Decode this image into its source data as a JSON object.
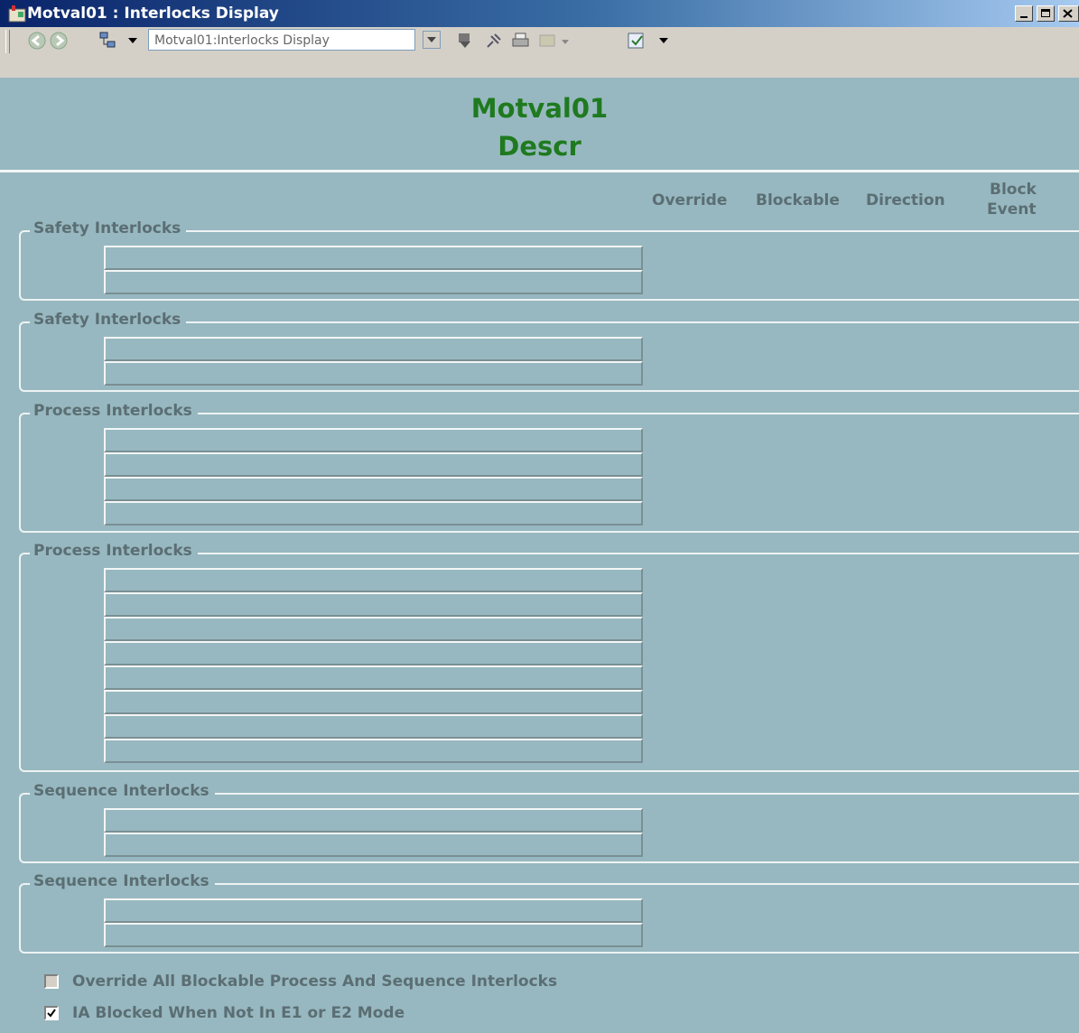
{
  "window": {
    "title": "Motval01 : Interlocks Display"
  },
  "toolbar": {
    "address_value": "Motval01:Interlocks Display",
    "icons": [
      "back-icon",
      "forward-icon",
      "network-icon",
      "download-icon",
      "pin-icon",
      "print-icon",
      "switch-icon",
      "checkmark-icon"
    ]
  },
  "header": {
    "title": "Motval01",
    "description": "Descr"
  },
  "columns": {
    "override": "Override",
    "blockable": "Blockable",
    "direction": "Direction",
    "block_event_1": "Block",
    "block_event_2": "Event"
  },
  "groups": [
    {
      "label": "Safety Interlocks",
      "rows": 2
    },
    {
      "label": "Safety Interlocks",
      "rows": 2
    },
    {
      "label": "Process Interlocks",
      "rows": 4
    },
    {
      "label": "Process Interlocks",
      "rows": 8
    },
    {
      "label": "Sequence Interlocks",
      "rows": 2
    },
    {
      "label": "Sequence Interlocks",
      "rows": 2
    }
  ],
  "options": [
    {
      "label": "Override All Blockable Process And Sequence Interlocks",
      "checked": false
    },
    {
      "label": "IA Blocked When Not In E1 or E2 Mode",
      "checked": true
    }
  ],
  "colors": {
    "background": "#97b8c0",
    "title_green": "#1f7a1f",
    "label_gray": "#5b6e73"
  }
}
